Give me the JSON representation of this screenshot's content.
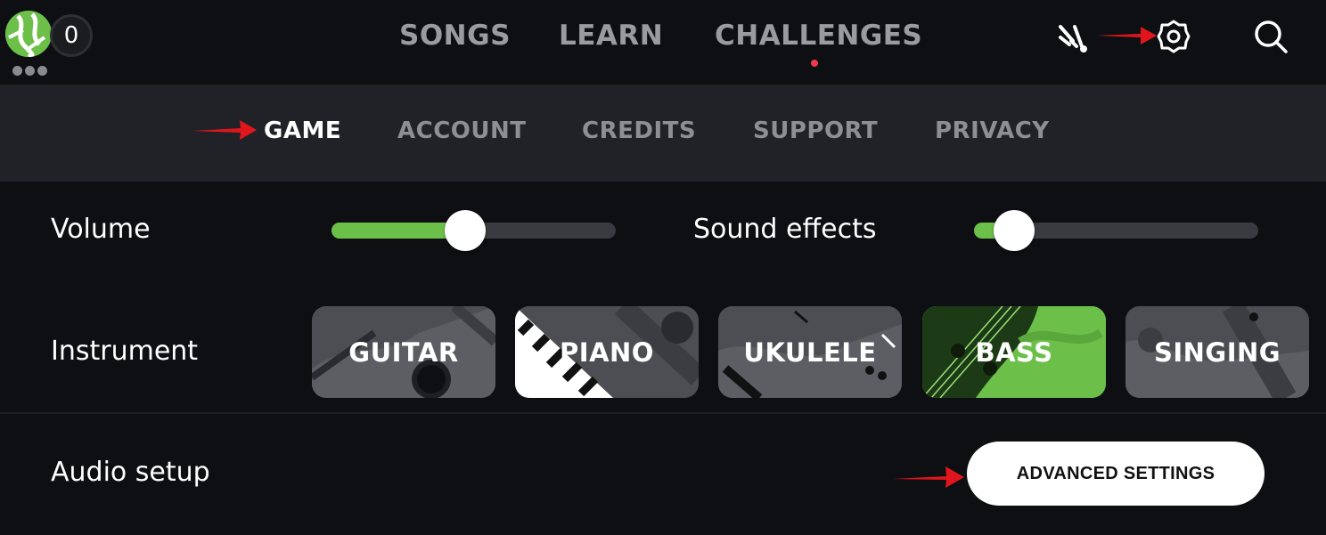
{
  "header": {
    "score": "0",
    "nav": [
      {
        "label": "SONGS"
      },
      {
        "label": "LEARN"
      },
      {
        "label": "CHALLENGES"
      }
    ],
    "icons": [
      "tuner-icon",
      "settings-gear-icon",
      "search-icon"
    ]
  },
  "settings_tabs": [
    {
      "label": "GAME"
    },
    {
      "label": "ACCOUNT"
    },
    {
      "label": "CREDITS"
    },
    {
      "label": "SUPPORT"
    },
    {
      "label": "PRIVACY"
    }
  ],
  "game": {
    "volume": {
      "label": "Volume",
      "value": 0.47
    },
    "sound_effects": {
      "label": "Sound effects",
      "value": 0.14
    },
    "instrument": {
      "label": "Instrument",
      "options": [
        {
          "label": "GUITAR"
        },
        {
          "label": "PIANO"
        },
        {
          "label": "UKULELE"
        },
        {
          "label": "BASS"
        },
        {
          "label": "SINGING"
        }
      ],
      "selected": "BASS"
    },
    "audio_setup": {
      "label": "Audio setup",
      "button": "ADVANCED SETTINGS"
    }
  },
  "colors": {
    "accent": "#6cc04a",
    "notification": "#ef3b4c",
    "annotation_arrow": "#e0161c"
  }
}
